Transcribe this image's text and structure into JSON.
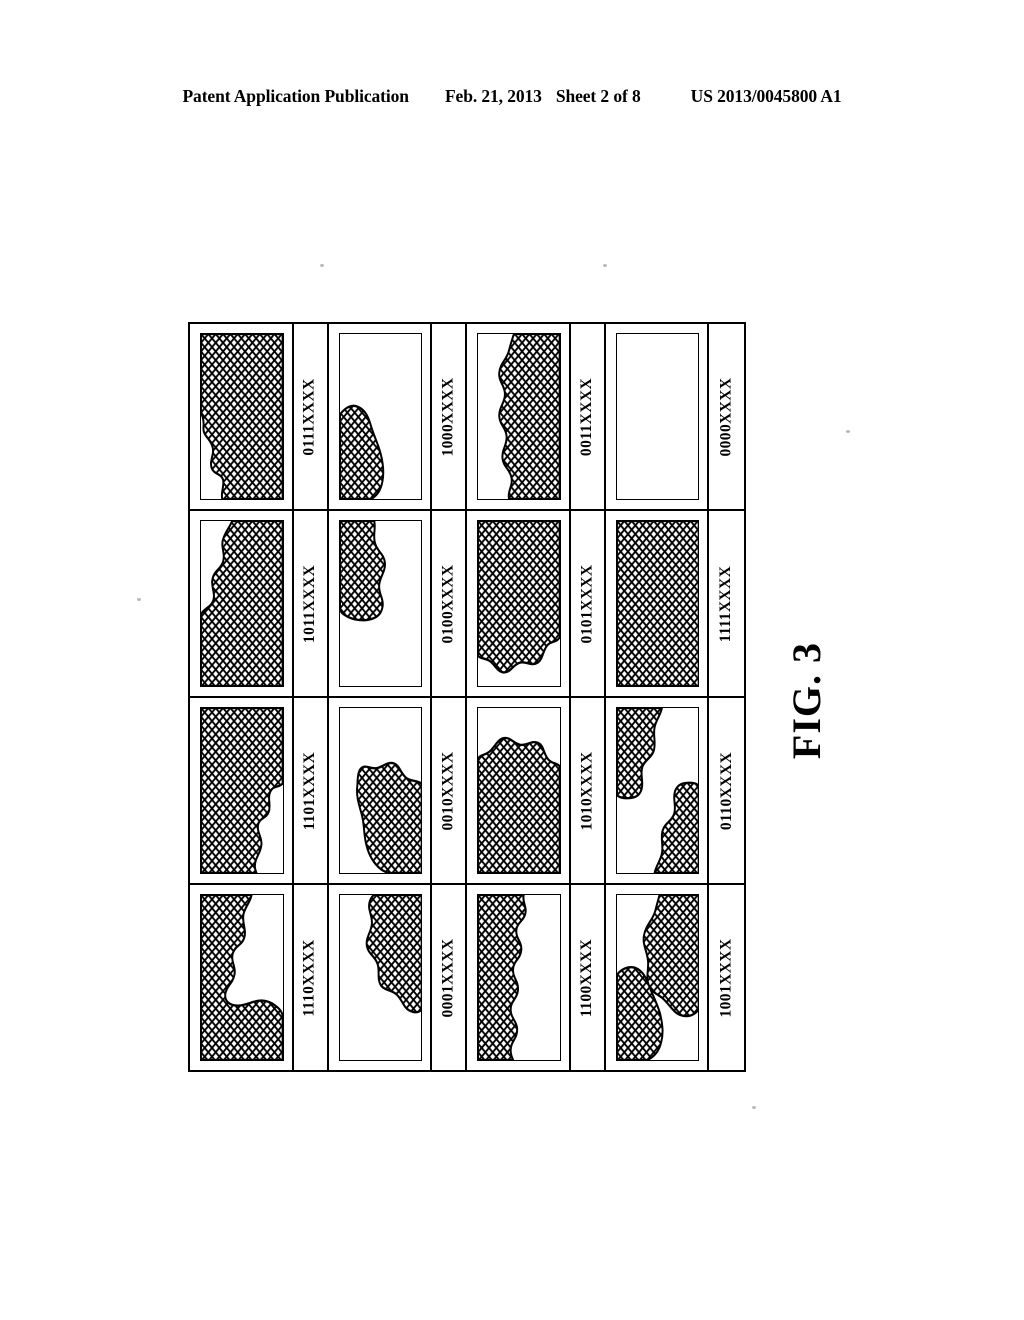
{
  "header": {
    "publication": "Patent Application Publication",
    "date": "Feb. 21, 2013",
    "sheet": "Sheet 2 of 8",
    "docnumber": "US 2013/0045800 A1"
  },
  "figure": {
    "caption": "FIG. 3",
    "hatch_color": "#000000",
    "line_color": "#000000",
    "background_color": "#ffffff",
    "rows": 4,
    "columns": 4,
    "cells": [
      {
        "label": "0111XXXX",
        "fill": "full_left_notch"
      },
      {
        "label": "1000XXXX",
        "fill": "blob_bottom_left"
      },
      {
        "label": "0011XXXX",
        "fill": "right_band"
      },
      {
        "label": "0000XXXX",
        "fill": "empty"
      },
      {
        "label": "1011XXXX",
        "fill": "right_mass_left_notch"
      },
      {
        "label": "0100XXXX",
        "fill": "blob_top_left"
      },
      {
        "label": "0101XXXX",
        "fill": "top_mass_scalloped"
      },
      {
        "label": "1111XXXX",
        "fill": "full"
      },
      {
        "label": "1101XXXX",
        "fill": "left_mass_right_notch"
      },
      {
        "label": "0010XXXX",
        "fill": "blob_bottom_right"
      },
      {
        "label": "1010XXXX",
        "fill": "bottom_mass_scalloped"
      },
      {
        "label": "0110XXXX",
        "fill": "two_corners_diagonal"
      },
      {
        "label": "1110XXXX",
        "fill": "left_mass_large"
      },
      {
        "label": "0001XXXX",
        "fill": "blob_top_right"
      },
      {
        "label": "1100XXXX",
        "fill": "left_band_wavy"
      },
      {
        "label": "1001XXXX",
        "fill": "two_blobs"
      }
    ]
  }
}
